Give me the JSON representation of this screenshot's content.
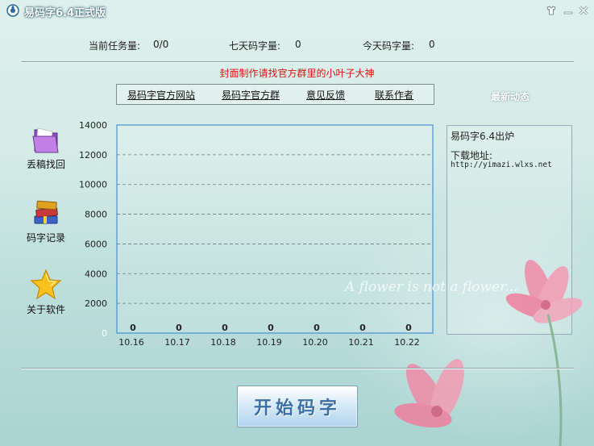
{
  "window": {
    "title": "易码字6.4正式版"
  },
  "stats": {
    "current_tasks_label": "当前任务量:",
    "current_tasks_value": "0/0",
    "seven_day_label": "七天码字量:",
    "seven_day_value": "0",
    "today_label": "今天码字量:",
    "today_value": "0"
  },
  "notice": "封面制作请找官方群里的小叶子大神",
  "links": [
    "易码字官方网站",
    "易码字官方群",
    "意见反馈",
    "联系作者"
  ],
  "news": {
    "title": "最新动态",
    "headline": "易码字6.4出炉",
    "download_label": "下载地址:",
    "download_url": "http://yimazi.wlxs.net"
  },
  "sidebar": {
    "items": [
      {
        "label": "丢稿找回",
        "icon": "folder-icon"
      },
      {
        "label": "码字记录",
        "icon": "books-icon"
      },
      {
        "label": "关于软件",
        "icon": "star-icon"
      }
    ]
  },
  "watermark": "A flower is not a flower...",
  "start_button": {
    "label": "开始码字"
  },
  "colors": {
    "notice": "#e01010",
    "chart_border": "#2f7fd0",
    "button_text": "#3b6fa6"
  },
  "chart_data": {
    "type": "bar",
    "categories": [
      "10.16",
      "10.17",
      "10.18",
      "10.19",
      "10.20",
      "10.21",
      "10.22"
    ],
    "values": [
      0,
      0,
      0,
      0,
      0,
      0,
      0
    ],
    "ylim": [
      0,
      14000
    ],
    "yticks": [
      0,
      2000,
      4000,
      6000,
      8000,
      10000,
      12000,
      14000
    ],
    "grid": true,
    "title": "",
    "xlabel": "",
    "ylabel": ""
  }
}
